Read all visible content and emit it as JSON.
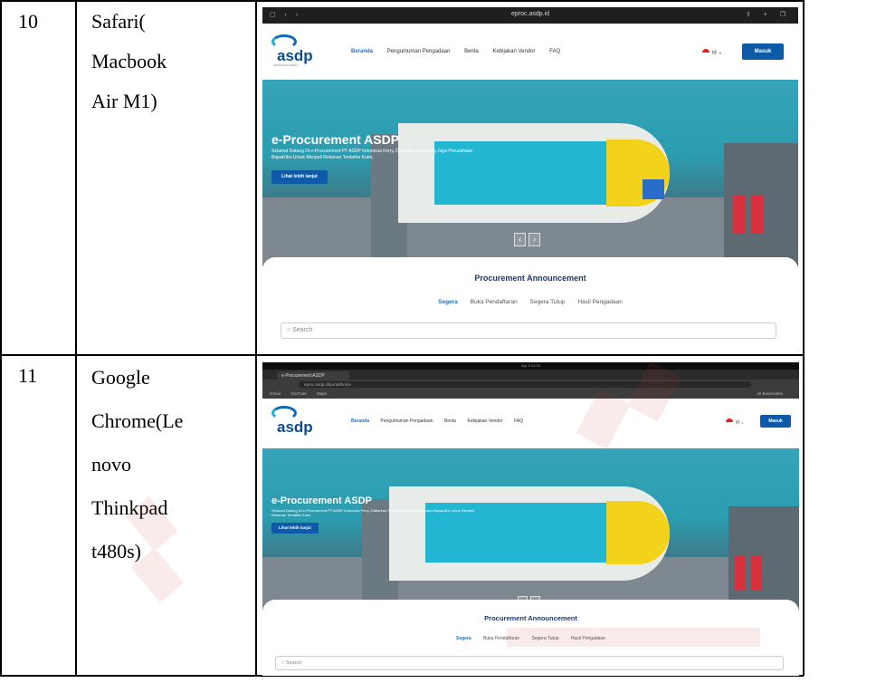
{
  "rows": [
    {
      "number": "10",
      "browser_lines": [
        "Safari(",
        "Macbook",
        "Air M1)"
      ],
      "screenshot": {
        "titlebar_url": "eproc.asdp.id",
        "nav_items": [
          "Beranda",
          "Pengumuman Pengadaan",
          "Berita",
          "Kebijakan Vendor",
          "FAQ"
        ],
        "lang": "id",
        "login": "Masuk",
        "hero_title": "e-Procurement ASDP",
        "hero_subtitle_1": "Selamat Datang Di e-Procurement PT ASDP Indonesia Ferry, Daftarkan Sekarang Juga Perusahaan",
        "hero_subtitle_2": "Bapak/Ibu Untuk Menjadi Rekanan Terdaftar Kami.",
        "hero_button": "Lihat lebih lanjut",
        "section_title": "Procurement Announcement",
        "tabs": [
          "Segera",
          "Buka Pendaftaran",
          "Segera Tutup",
          "Hasil Pengadaan"
        ],
        "search_placeholder": "Search"
      }
    },
    {
      "number": "11",
      "browser_lines": [
        "Google",
        "Chrome(Le",
        "novo",
        "Thinkpad",
        "t480s)"
      ],
      "screenshot": {
        "clock": "Apr 9 14:29",
        "tab_title": "e-Procurement ASDP",
        "address": "eproc.asdp.id/portal/home",
        "bookmarks": [
          "Gmail",
          "YouTube",
          "Maps"
        ],
        "all_bookmarks": "All Bookmarks",
        "nav_items": [
          "Beranda",
          "Pengumuman Pengadaan",
          "Berita",
          "Kebijakan Vendor",
          "FAQ"
        ],
        "lang": "id",
        "login": "Masuk",
        "hero_title": "e-Procurement ASDP",
        "hero_subtitle_1": "Selamat Datang Di e-Procurement PT ASDP Indonesia Ferry, Daftarkan Sekarang Juga Perusahaan Bapak/Ibu Untuk Menjadi",
        "hero_subtitle_2": "Rekanan Terdaftar Kami.",
        "hero_button": "Lihat lebih lanjut",
        "section_title": "Procurement Announcement",
        "tabs": [
          "Segera",
          "Buka Pendaftaran",
          "Segera Tutup",
          "Hasil Pengadaan"
        ],
        "search_placeholder": "Search"
      }
    }
  ],
  "colors": {
    "brand_blue": "#0f5aa8",
    "active_link": "#1a73c8",
    "sea": "#2b9db0",
    "watermark": "#d23c3c"
  },
  "icons": [
    "asdp-logo-icon",
    "indonesia-flag-icon",
    "search-icon",
    "chevron-left-icon",
    "chevron-right-icon"
  ]
}
